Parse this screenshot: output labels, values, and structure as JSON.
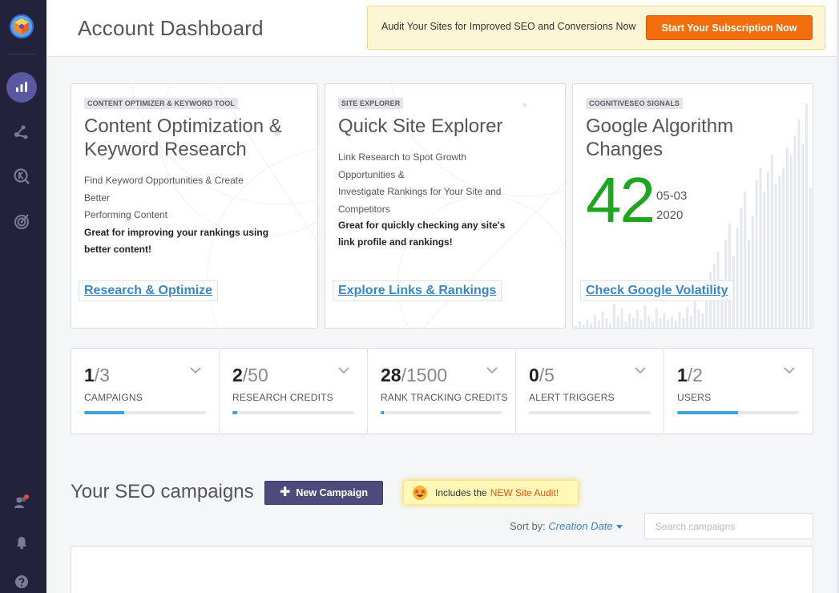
{
  "header": {
    "title": "Account Dashboard",
    "promo_text": "Audit Your Sites for Improved SEO and Conversions Now",
    "promo_button": "Start Your Subscription Now"
  },
  "sidebar": {
    "items": [
      {
        "icon": "bar-chart-icon",
        "active": true
      },
      {
        "icon": "link-nodes-icon"
      },
      {
        "icon": "keyword-search-icon"
      },
      {
        "icon": "target-icon"
      },
      {
        "icon": "users-icon"
      },
      {
        "icon": "bell-icon"
      },
      {
        "icon": "help-icon"
      }
    ]
  },
  "cards": [
    {
      "tag": "CONTENT OPTIMIZER & KEYWORD TOOL",
      "title_lines": [
        "Content Optimization &",
        "Keyword Research"
      ],
      "desc_lines": [
        "Find Keyword Opportunities & Create",
        "Better",
        "Performing Content"
      ],
      "bold_lines": [
        "Great for improving your rankings using",
        "better content!"
      ],
      "link": "Research & Optimize"
    },
    {
      "tag": "SITE EXPLORER",
      "title_lines": [
        "Quick Site Explorer"
      ],
      "desc_lines": [
        "Link Research to Spot Growth",
        "Opportunities &",
        "Investigate Rankings for Your Site and",
        "Competitors"
      ],
      "bold_lines": [
        "Great for quickly checking any site's",
        "link profile and rankings!"
      ],
      "link": "Explore Links & Rankings"
    },
    {
      "tag": "COGNITIVESEO SIGNALS",
      "title_lines": [
        "Google Algorithm",
        "Changes"
      ],
      "number": "42",
      "date_lines": [
        "05-03",
        "2020"
      ],
      "link": "Check Google Volatility",
      "number_color": "#1fa51f"
    }
  ],
  "stats": [
    {
      "used": "1",
      "total": "/3",
      "label": "CAMPAIGNS",
      "fraction": 0.33
    },
    {
      "used": "2",
      "total": "/50",
      "label": "RESEARCH CREDITS",
      "fraction": 0.04
    },
    {
      "used": "28",
      "total": "/1500",
      "label": "RANK TRACKING CREDITS",
      "fraction": 0.019
    },
    {
      "used": "0",
      "total": "/5",
      "label": "ALERT TRIGGERS",
      "fraction": 0
    },
    {
      "used": "1",
      "total": "/2",
      "label": "USERS",
      "fraction": 0.5
    }
  ],
  "campaigns": {
    "title": "Your SEO campaigns",
    "new_button": "New Campaign",
    "badge_prefix": "Includes the",
    "badge_highlight": "NEW Site Audit!",
    "sort_label": "Sort by:",
    "sort_value": "Creation Date",
    "search_placeholder": "Search campaigns"
  },
  "colors": {
    "sidebar_bg": "#22233b",
    "accent_purple": "#5a58a3",
    "promo_orange": "#f26d0b",
    "link_blue": "#3a86c8",
    "progress_blue": "#3aa3e3",
    "number_green": "#1fa51f"
  }
}
